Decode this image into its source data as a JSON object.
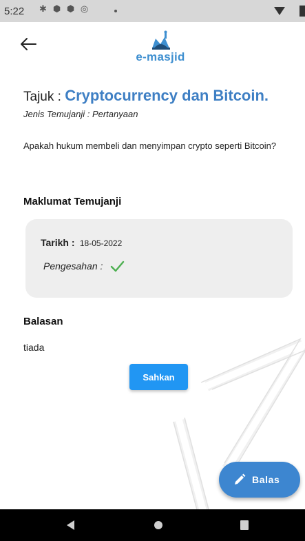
{
  "status_bar": {
    "time": "5:22",
    "icons": [
      "gear-icon",
      "shield-icon",
      "shield-icon",
      "at-icon",
      "dot-icon",
      "wifi-icon",
      "battery-icon"
    ]
  },
  "app_bar": {
    "logo_text": "e-masjid"
  },
  "appointment": {
    "title_label": "Tajuk :",
    "title_value": "Cryptocurrency dan Bitcoin.",
    "type_line": "Jenis Temujanji : Pertanyaan",
    "question": "Apakah hukum membeli dan menyimpan crypto seperti Bitcoin?"
  },
  "details": {
    "section_title": "Maklumat Temujanji",
    "date_label": "Tarikh :",
    "date_value": "18-05-2022",
    "confirm_label": "Pengesahan :"
  },
  "reply": {
    "section_title": "Balasan",
    "text": "tiada",
    "confirm_button": "Sahkan"
  },
  "fab": {
    "label": "Balas"
  },
  "colors": {
    "accent": "#3e7fc4",
    "button": "#2196f3",
    "fab": "#3d86d0",
    "check": "#4caf50",
    "card": "#eeeeee"
  }
}
